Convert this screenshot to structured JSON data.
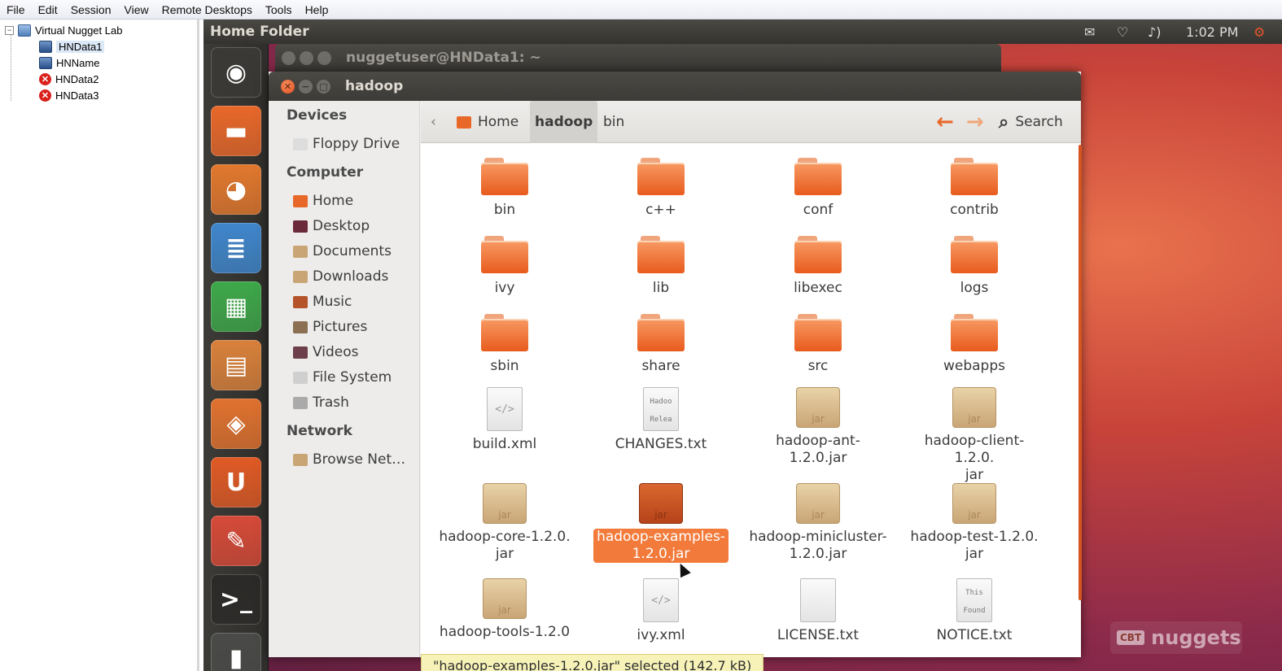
{
  "menu": [
    "File",
    "Edit",
    "Session",
    "View",
    "Remote Desktops",
    "Tools",
    "Help"
  ],
  "tree": {
    "root": "Virtual Nugget Lab",
    "expander": "−",
    "nodes": [
      {
        "label": "HNData1",
        "status": "online",
        "selected": true
      },
      {
        "label": "HNName",
        "status": "online",
        "selected": false
      },
      {
        "label": "HNData2",
        "status": "error",
        "selected": false
      },
      {
        "label": "HNData3",
        "status": "error",
        "selected": false
      }
    ],
    "error_glyph": "✕"
  },
  "topbar": {
    "title": "Home Folder",
    "time": "1:02 PM",
    "indicators": [
      "mail-icon",
      "network-icon",
      "volume-icon",
      "power-icon"
    ]
  },
  "launcher": {
    "items": [
      {
        "name": "dash",
        "glyph": "◉",
        "color": "#3a3936"
      },
      {
        "name": "files",
        "glyph": "▬",
        "color": "#e8682a"
      },
      {
        "name": "firefox",
        "glyph": "◕",
        "color": "#e2782e"
      },
      {
        "name": "writer",
        "glyph": "≣",
        "color": "#3f86cc"
      },
      {
        "name": "calc",
        "glyph": "▦",
        "color": "#3ea84a"
      },
      {
        "name": "impress",
        "glyph": "▤",
        "color": "#d9813b"
      },
      {
        "name": "software-center",
        "glyph": "◈",
        "color": "#e0722f"
      },
      {
        "name": "ubuntu-one",
        "glyph": "U",
        "color": "#e05a25"
      },
      {
        "name": "system-settings",
        "glyph": "✎",
        "color": "#d64a38"
      },
      {
        "name": "terminal",
        "glyph": ">_",
        "color": "#2b2a28"
      },
      {
        "name": "trash",
        "glyph": "▮",
        "color": "#4a4a48"
      }
    ]
  },
  "terminal_window": {
    "title": "nuggetuser@HNData1: ~"
  },
  "file_manager": {
    "title": "hadoop",
    "window_controls": {
      "close": "✕",
      "minimize": "−",
      "maximize": "□"
    },
    "sidebar": {
      "sections": [
        {
          "header": "Devices",
          "items": [
            {
              "label": "Floppy Drive",
              "icon": "floppy-icon"
            }
          ]
        },
        {
          "header": "Computer",
          "items": [
            {
              "label": "Home",
              "icon": "home-icon"
            },
            {
              "label": "Desktop",
              "icon": "desktop-icon"
            },
            {
              "label": "Documents",
              "icon": "documents-icon"
            },
            {
              "label": "Downloads",
              "icon": "downloads-icon"
            },
            {
              "label": "Music",
              "icon": "music-icon"
            },
            {
              "label": "Pictures",
              "icon": "pictures-icon"
            },
            {
              "label": "Videos",
              "icon": "videos-icon"
            },
            {
              "label": "File System",
              "icon": "filesystem-icon"
            },
            {
              "label": "Trash",
              "icon": "trash-icon"
            }
          ]
        },
        {
          "header": "Network",
          "items": [
            {
              "label": "Browse Net…",
              "icon": "network-browse-icon"
            }
          ]
        }
      ]
    },
    "pathbar": {
      "crumbs": [
        "Home",
        "hadoop",
        "bin"
      ],
      "active": "hadoop",
      "back_glyph": "←",
      "forward_glyph": "→",
      "search_glyph": "⌕",
      "search_label": "Search",
      "left_arrow": "‹"
    },
    "files": [
      {
        "name": "bin",
        "type": "folder"
      },
      {
        "name": "c++",
        "type": "folder"
      },
      {
        "name": "conf",
        "type": "folder"
      },
      {
        "name": "contrib",
        "type": "folder"
      },
      {
        "name": "ivy",
        "type": "folder"
      },
      {
        "name": "lib",
        "type": "folder"
      },
      {
        "name": "libexec",
        "type": "folder"
      },
      {
        "name": "logs",
        "type": "folder"
      },
      {
        "name": "sbin",
        "type": "folder"
      },
      {
        "name": "share",
        "type": "folder"
      },
      {
        "name": "src",
        "type": "folder"
      },
      {
        "name": "webapps",
        "type": "folder"
      },
      {
        "name": "build.xml",
        "type": "xml"
      },
      {
        "name": "CHANGES.txt",
        "type": "txt",
        "preview": "Hadoo Relea"
      },
      {
        "name": "hadoop-ant-1.2.0.jar",
        "type": "jar"
      },
      {
        "name": "hadoop-client-1.2.0.jar",
        "type": "jar",
        "line1": "hadoop-client-1.2.0.",
        "line2": "jar"
      },
      {
        "name": "hadoop-core-1.2.0.jar",
        "type": "jar",
        "line1": "hadoop-core-1.2.0.",
        "line2": "jar"
      },
      {
        "name": "hadoop-examples-1.2.0.jar",
        "type": "jar",
        "selected": true,
        "line1": "hadoop-examples-",
        "line2": "1.2.0.jar"
      },
      {
        "name": "hadoop-minicluster-1.2.0.jar",
        "type": "jar",
        "line1": "hadoop-minicluster-",
        "line2": "1.2.0.jar"
      },
      {
        "name": "hadoop-test-1.2.0.jar",
        "type": "jar",
        "line1": "hadoop-test-1.2.0.",
        "line2": "jar"
      },
      {
        "name": "hadoop-tools-1.2.0",
        "type": "jar"
      },
      {
        "name": "ivy.xml",
        "type": "xml"
      },
      {
        "name": "LICENSE.txt",
        "type": "txt",
        "preview": ""
      },
      {
        "name": "NOTICE.txt",
        "type": "txt",
        "preview": "This Found"
      }
    ],
    "jar_label": "jar",
    "xml_glyph": "</>",
    "status": "\"hadoop-examples-1.2.0.jar\" selected (142.7 kB)"
  },
  "watermark": {
    "cbt": "CBT",
    "text": "nuggets"
  }
}
